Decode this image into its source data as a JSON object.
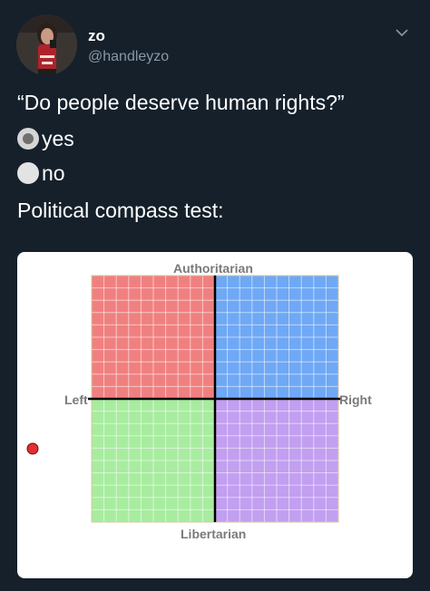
{
  "tweet": {
    "author": {
      "display_name": "zo",
      "handle": "@handleyzo"
    },
    "question": "“Do people deserve human rights?”",
    "poll": [
      {
        "label": "yes",
        "selected": true
      },
      {
        "label": "no",
        "selected": false
      }
    ],
    "caption": "Political compass test:"
  },
  "compass": {
    "top_label": "Authoritarian",
    "bottom_label": "Libertarian",
    "left_label": "Left",
    "right_label": "Right",
    "colors": {
      "authoritarian_left": "#f08080",
      "authoritarian_right": "#6fa8f5",
      "libertarian_left": "#a8eca0",
      "libertarian_right": "#c29ff0",
      "marker": "#e03030"
    }
  },
  "icons": {
    "menu": "chevron-down-icon"
  }
}
